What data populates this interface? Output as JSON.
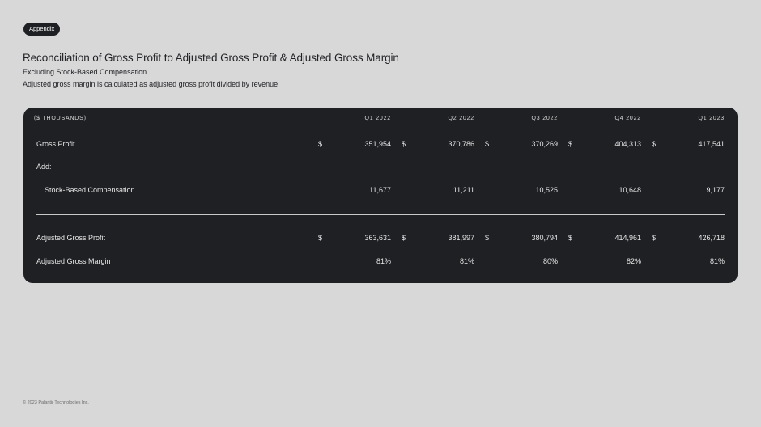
{
  "tag": "Appendix",
  "title": "Reconciliation of Gross Profit to Adjusted Gross Profit & Adjusted Gross Margin",
  "subtitle1": "Excluding Stock-Based Compensation",
  "subtitle2": "Adjusted gross margin is calculated as adjusted gross profit divided by revenue",
  "table": {
    "unit_label": "($ THOUSANDS)",
    "columns": [
      "Q1 2022",
      "Q2 2022",
      "Q3 2022",
      "Q4 2022",
      "Q1 2023"
    ],
    "rows": [
      {
        "label": "Gross Profit",
        "currency": "$",
        "values": [
          "351,954",
          "370,786",
          "370,269",
          "404,313",
          "417,541"
        ]
      },
      {
        "label": "Add:"
      },
      {
        "label": "Stock-Based Compensation",
        "values": [
          "11,677",
          "11,211",
          "10,525",
          "10,648",
          "9,177"
        ]
      },
      {
        "label": "Adjusted Gross Profit",
        "currency": "$",
        "values": [
          "363,631",
          "381,997",
          "380,794",
          "414,961",
          "426,718"
        ]
      },
      {
        "label": "Adjusted Gross Margin",
        "values": [
          "81%",
          "81%",
          "80%",
          "82%",
          "81%"
        ]
      }
    ]
  },
  "footer": "© 2023 Palantir Technologies Inc."
}
